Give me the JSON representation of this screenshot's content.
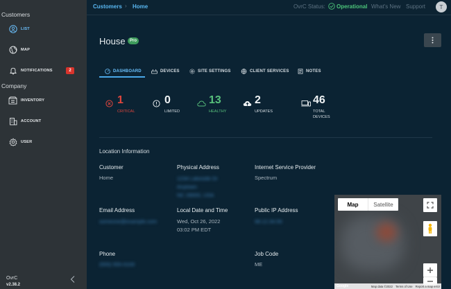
{
  "sidebar": {
    "sections": [
      "Customers",
      "Company"
    ],
    "items": [
      {
        "label": "LIST",
        "icon": "user-circle-icon"
      },
      {
        "label": "MAP",
        "icon": "globe-icon"
      },
      {
        "label": "NOTIFICATIONS",
        "icon": "bell-icon",
        "badge": "2"
      },
      {
        "label": "INVENTORY",
        "icon": "inventory-icon"
      },
      {
        "label": "ACCOUNT",
        "icon": "building-icon"
      },
      {
        "label": "USER",
        "icon": "gear-icon"
      }
    ],
    "brand": "OvrC",
    "version": "v2.38.2"
  },
  "topbar": {
    "breadcrumb": [
      "Customers",
      "Home"
    ],
    "status_label": "OvrC Status:",
    "status_value": "Operational",
    "whats_new": "What's New",
    "support": "Support",
    "avatar_initial": "T"
  },
  "site": {
    "title": "House",
    "plan_badge": "Pro"
  },
  "tabs": [
    {
      "label": "DASHBOARD",
      "icon": "dashboard-icon"
    },
    {
      "label": "DEVICES",
      "icon": "router-icon"
    },
    {
      "label": "SITE SETTINGS",
      "icon": "gear-icon"
    },
    {
      "label": "CLIENT SERVICES",
      "icon": "services-icon"
    },
    {
      "label": "NOTES",
      "icon": "notes-icon"
    }
  ],
  "stats": [
    {
      "value": "1",
      "label": "CRITICAL",
      "icon": "critical-icon"
    },
    {
      "value": "0",
      "label": "LIMITED",
      "icon": "info-icon"
    },
    {
      "value": "13",
      "label": "HEALTHY",
      "icon": "cloud-icon"
    },
    {
      "value": "2",
      "label": "UPDATES",
      "icon": "cloud-upload-icon"
    },
    {
      "value": "46",
      "label": "TOTAL\nDEVICES",
      "icon": "devices-icon"
    }
  ],
  "location": {
    "section_title": "Location Information",
    "customer_label": "Customer",
    "customer_value": "Home",
    "address_label": "Physical Address",
    "address_lines": [
      "1234 Lakeside Dr",
      "Anytown",
      "NC 28000, USA"
    ],
    "isp_label": "Internet Service Provider",
    "isp_value": "Spectrum",
    "email_label": "Email Address",
    "email_value": "someone@example.com",
    "datetime_label": "Local Date and Time",
    "date_value": "Wed, Oct 26, 2022",
    "time_value": "03:02 PM EDT",
    "ip_label": "Public IP Address",
    "ip_value": "98.12.34.56",
    "phone_label": "Phone",
    "phone_value": "(555) 555-0100",
    "job_label": "Job Code",
    "job_value": "ME"
  },
  "map": {
    "map_label": "Map",
    "satellite_label": "Satellite",
    "footer": [
      "Map data ©2022",
      "Terms of Use",
      "Report a map error"
    ],
    "google": "Google"
  },
  "colors": {
    "critical": "#e0463d",
    "healthy": "#58c07c",
    "accent": "#4aa8e8",
    "sidebar": "#2d3337",
    "background": "#0b2333"
  }
}
